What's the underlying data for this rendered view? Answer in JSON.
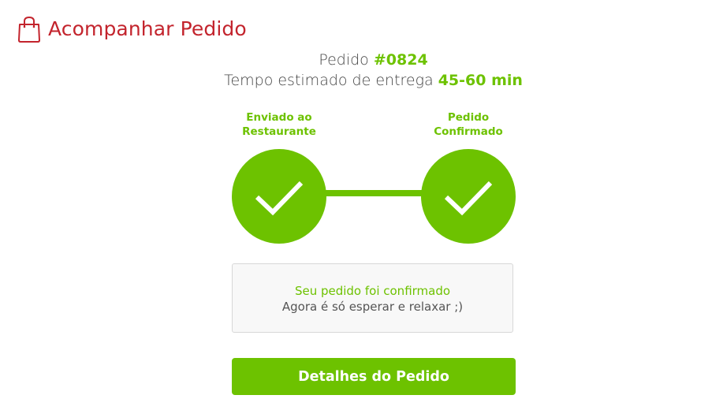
{
  "header": {
    "icon": "shopping-bag-icon",
    "title": "Acompanhar Pedido"
  },
  "order": {
    "number_prefix": "Pedido ",
    "number": "#0824",
    "eta_prefix": "Tempo estimado de entrega ",
    "eta": "45-60 min"
  },
  "steps": [
    {
      "label_line1": "Enviado ao",
      "label_line2": "Restaurante",
      "icon": "check-icon",
      "done": true
    },
    {
      "label_line1": "Pedido",
      "label_line2": "Confirmado",
      "icon": "check-icon",
      "done": true
    }
  ],
  "status": {
    "title": "Seu pedido foi confirmado",
    "subtitle": "Agora é só esperar e relaxar ;)"
  },
  "actions": {
    "details_label": "Detalhes do Pedido"
  },
  "colors": {
    "brand_red": "#c3242d",
    "accent_green": "#6dc200"
  }
}
